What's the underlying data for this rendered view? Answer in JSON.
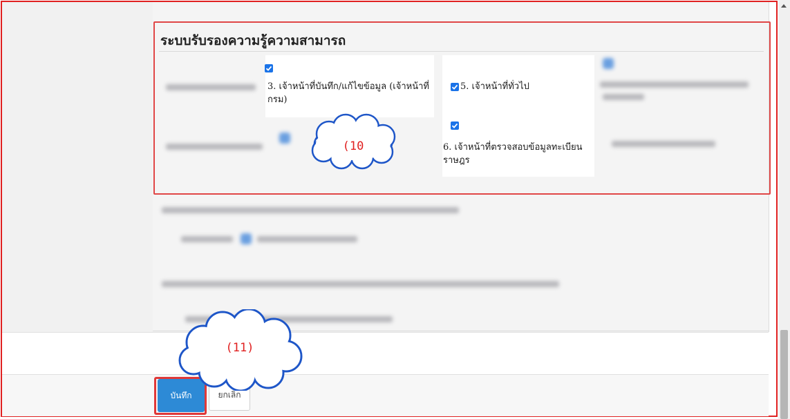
{
  "section": {
    "title": "ระบบรับรองความรู้ความสามารถ"
  },
  "roles": [
    {
      "label": "3. เจ้าหน้าที่บันทึก/แก้ไขข้อมูล (เจ้าหน้าที่กรม)",
      "checked": true
    },
    {
      "label": "5. เจ้าหน้าที่ทั่วไป",
      "checked": true
    },
    {
      "label": "6. เจ้าหน้าที่ตรวจสอบข้อมูลทะเบียนราษฎร",
      "checked": true
    }
  ],
  "callouts": {
    "c10": "(10",
    "c11": "(11)"
  },
  "buttons": {
    "save": "บันทึก",
    "cancel": "ยกเลิก"
  },
  "colors": {
    "accent": "#2d8ad6",
    "highlight": "#e04545",
    "callout_text": "#e02020"
  }
}
